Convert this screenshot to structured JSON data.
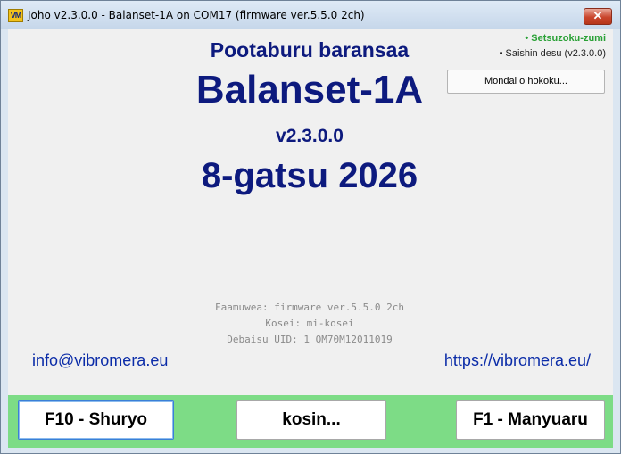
{
  "window": {
    "title": "Joho v2.3.0.0 - Balanset-1A on COM17 (firmware ver.5.5.0 2ch)",
    "app_icon_text": "VM",
    "close_glyph": "✕"
  },
  "about": {
    "subtitle": "Pootaburu baransaa",
    "product": "Balanset-1A",
    "version": "v2.3.0.0",
    "date": "8-gatsu 2026"
  },
  "status": {
    "connected": "• Setsuzoku-zumi",
    "latest": "• Saishin desu (v2.3.0.0)"
  },
  "report_button": "Mondai o hokoku...",
  "device_info": {
    "firmware": "Faamuwea: firmware ver.5.5.0 2ch",
    "calibration": "Kosei: mi-kosei",
    "uid": "Debaisu UID: 1 QM70M12011019"
  },
  "links": {
    "email": "info@vibromera.eu",
    "website": "https://vibromera.eu/"
  },
  "footer": {
    "exit_label": "F10 - Shuryo",
    "update_label": "kosin...",
    "manual_label": "F1 - Manyuaru"
  },
  "colors": {
    "title_text": "#0d1a7e",
    "connected_status": "#2aa136",
    "footer_bar": "#7ddc86",
    "link": "#0b2ca8"
  },
  "icons": {
    "app": "vibromera-app-icon",
    "close": "close-icon"
  }
}
